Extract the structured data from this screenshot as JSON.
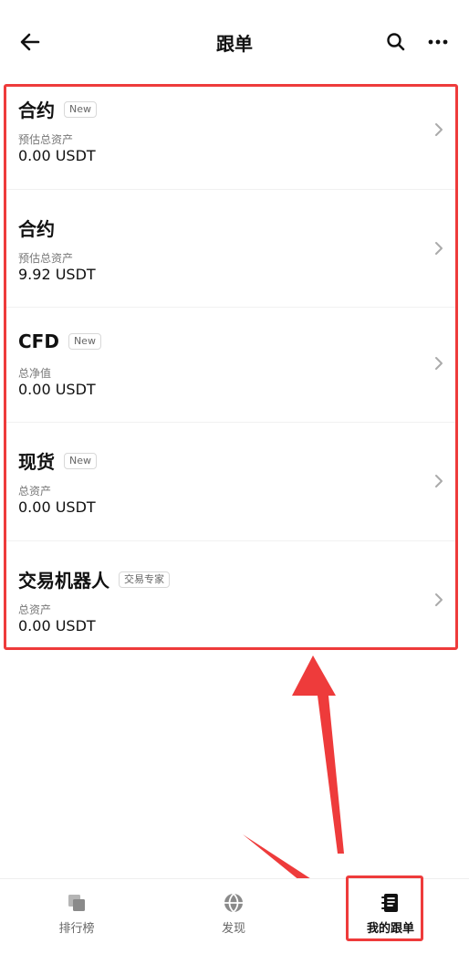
{
  "header": {
    "title": "跟单"
  },
  "rows": [
    {
      "title": "合约",
      "badge": "New",
      "sublabel": "预估总资产",
      "value": "0.00 USDT"
    },
    {
      "title": "合约",
      "badge": "",
      "sublabel": "预估总资产",
      "value": "9.92 USDT"
    },
    {
      "title": "CFD",
      "badge": "New",
      "sublabel": "总净值",
      "value": "0.00 USDT"
    },
    {
      "title": "现货",
      "badge": "New",
      "sublabel": "总资产",
      "value": "0.00 USDT"
    },
    {
      "title": "交易机器人",
      "badge": "交易专家",
      "sublabel": "总资产",
      "value": "0.00 USDT"
    }
  ],
  "bottom_nav": [
    {
      "label": "排行榜",
      "icon": "copy-icon",
      "active": false
    },
    {
      "label": "发现",
      "icon": "globe-icon",
      "active": false
    },
    {
      "label": "我的跟单",
      "icon": "notebook-icon",
      "active": true
    }
  ],
  "colors": {
    "highlight": "#ee3b3b",
    "text_primary": "#111111",
    "text_secondary": "#777777"
  }
}
